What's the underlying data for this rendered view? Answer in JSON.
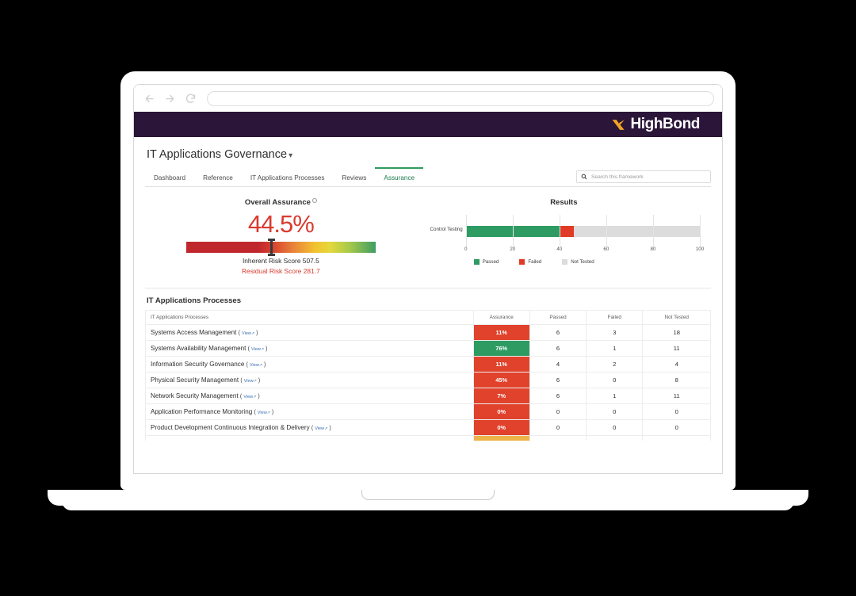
{
  "browser": {
    "back_icon": "arrow-left-icon",
    "forward_icon": "arrow-right-icon",
    "reload_icon": "reload-icon",
    "url_value": ""
  },
  "app_header": {
    "brand_name": "HighBond",
    "brand_mark": "highbond-x-icon",
    "bg_color": "#2b1538",
    "mark_color": "#f0a524"
  },
  "page": {
    "title": "IT Applications Governance",
    "title_caret": "▾"
  },
  "tabs": [
    {
      "label": "Dashboard",
      "active": false
    },
    {
      "label": "Reference",
      "active": false
    },
    {
      "label": "IT Applications Processes",
      "active": false
    },
    {
      "label": "Reviews",
      "active": false
    },
    {
      "label": "Assurance",
      "active": true
    }
  ],
  "search": {
    "placeholder": "Search this framework",
    "value": "",
    "icon": "search-icon"
  },
  "overall_assurance": {
    "title": "Overall Assurance",
    "info_icon": "info-icon",
    "percent": "44.5%",
    "percent_value": 44.5,
    "percent_color": "#d93b30",
    "inherent_risk_label": "Inherent Risk Score 507.5",
    "residual_risk_label": "Residual Risk Score 281.7"
  },
  "chart_data": {
    "type": "bar",
    "title": "Results",
    "orientation": "horizontal",
    "stacked": true,
    "categories": [
      "Control Testing"
    ],
    "series": [
      {
        "name": "Passed",
        "values": [
          40
        ],
        "color": "#2e9b63"
      },
      {
        "name": "Failed",
        "values": [
          6
        ],
        "color": "#e03b26"
      },
      {
        "name": "Not Tested",
        "values": [
          54
        ],
        "color": "#dcdcdc"
      }
    ],
    "xlabel": "",
    "ylabel": "",
    "xlim": [
      0,
      100
    ],
    "xticks": [
      0,
      20,
      40,
      60,
      80,
      100
    ],
    "grid": true,
    "legend_position": "bottom"
  },
  "processes_table": {
    "section_title": "IT Applications Processes",
    "columns": [
      "IT Applications Processes",
      "Assurance",
      "Passed",
      "Failed",
      "Not Tested"
    ],
    "view_label": "View",
    "view_arrow": "↗",
    "rows": [
      {
        "name": "Systems Access Management",
        "assurance": "11%",
        "assurance_color": "#e0422c",
        "passed": "6",
        "failed": "3",
        "not_tested": "18"
      },
      {
        "name": "Systems Availability Management",
        "assurance": "76%",
        "assurance_color": "#2e9b63",
        "passed": "6",
        "failed": "1",
        "not_tested": "11"
      },
      {
        "name": "Information Security Governance",
        "assurance": "11%",
        "assurance_color": "#e0422c",
        "passed": "4",
        "failed": "2",
        "not_tested": "4"
      },
      {
        "name": "Physical Security Management",
        "assurance": "45%",
        "assurance_color": "#e0422c",
        "passed": "6",
        "failed": "0",
        "not_tested": "8"
      },
      {
        "name": "Network Security Management",
        "assurance": "7%",
        "assurance_color": "#e0422c",
        "passed": "6",
        "failed": "1",
        "not_tested": "11"
      },
      {
        "name": "Application Performance Monitoring",
        "assurance": "0%",
        "assurance_color": "#e0422c",
        "passed": "0",
        "failed": "0",
        "not_tested": "0"
      },
      {
        "name": "Product Development Continuous Integration & Delivery",
        "assurance": "0%",
        "assurance_color": "#e0422c",
        "passed": "0",
        "failed": "0",
        "not_tested": "0"
      }
    ],
    "partial_row_color": "#edb44a"
  }
}
